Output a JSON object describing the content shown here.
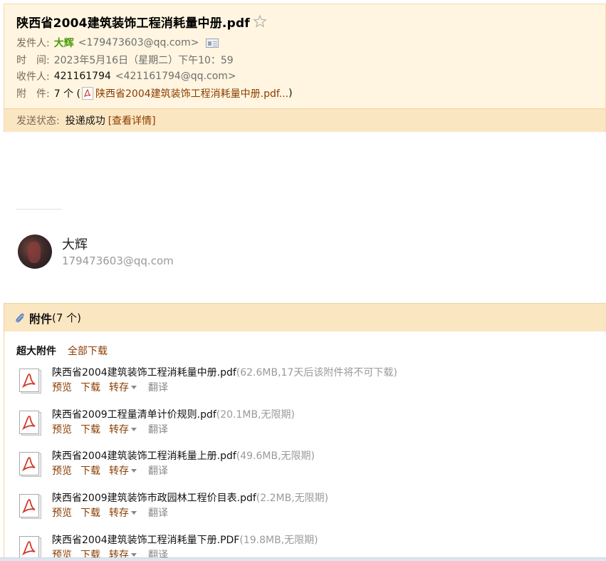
{
  "mail": {
    "subject": "陕西省2004建筑装饰工程消耗量中册.pdf",
    "star_icon": "star-outline-icon",
    "from_label": "发件人:",
    "from_name": "大辉",
    "from_email": "<179473603@qq.com>",
    "time_label": "时　间:",
    "time_value": "2023年5月16日（星期二）下午10：59",
    "to_label": "收件人:",
    "to_name": "421161794",
    "to_email": "<421161794@qq.com>",
    "attach_label": "附　件:",
    "attach_count": "7 个 (",
    "attach_first": "陕西省2004建筑装饰工程消耗量中册.pdf...",
    "attach_close": ")",
    "status_label": "发送状态:",
    "status_value": "投递成功",
    "status_link": "[查看详情]"
  },
  "signature": {
    "name": "大辉",
    "email": "179473603@qq.com"
  },
  "attachments": {
    "title": "附件",
    "count": "(7 个)",
    "super_label": "超大附件",
    "download_all": "全部下载",
    "actions": {
      "preview": "预览",
      "download": "下载",
      "save": "转存",
      "translate": "翻译"
    },
    "files": [
      {
        "name": "陕西省2004建筑装饰工程消耗量中册.pdf",
        "meta": "(62.6MB,17天后该附件将不可下载)"
      },
      {
        "name": "陕西省2009工程量清单计价规则.pdf",
        "meta": "(20.1MB,无限期)"
      },
      {
        "name": "陕西省2004建筑装饰工程消耗量上册.pdf",
        "meta": "(49.6MB,无限期)"
      },
      {
        "name": "陕西省2009建筑装饰市政园林工程价目表.pdf",
        "meta": "(2.2MB,无限期)"
      },
      {
        "name": "陕西省2004建筑装饰工程消耗量下册.PDF",
        "meta": "(19.8MB,无限期)"
      }
    ]
  },
  "colors": {
    "header_bg": "#fff5e0",
    "status_bg": "#fbe6c2",
    "link": "#8b3d00",
    "sender_green": "#4a9a0a"
  }
}
